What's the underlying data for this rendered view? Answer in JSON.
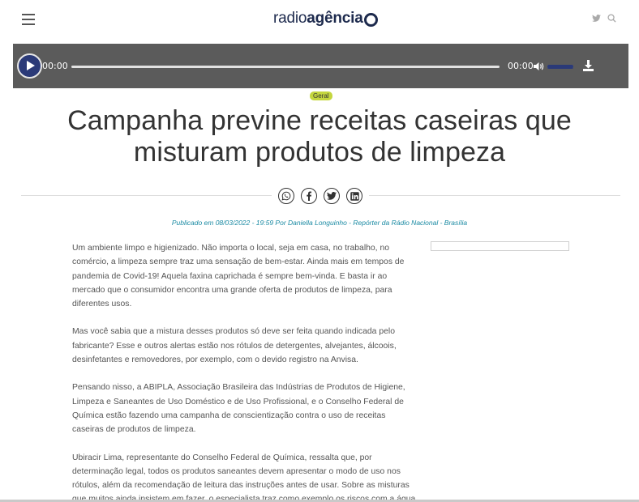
{
  "header": {
    "menu_icon": "hamburger-icon",
    "logo_light": "radio",
    "logo_bold": "agência",
    "icons": [
      "twitter-icon",
      "search-icon"
    ]
  },
  "player": {
    "current_time": "00:00",
    "duration": "00:00",
    "progress": 0,
    "volume": 1.0,
    "icons": [
      "play-icon",
      "volume-icon",
      "download-icon"
    ]
  },
  "article": {
    "category": "Geral",
    "title": "Campanha previne receitas caseiras que misturam produtos de limpeza",
    "share_icons": [
      "whatsapp-icon",
      "facebook-icon",
      "twitter-icon",
      "linkedin-icon"
    ],
    "byline": "Publicado em 08/03/2022 - 19:59 Por Daniella Longuinho - Repórter da Rádio Nacional - Brasília",
    "paragraphs": [
      "Um ambiente limpo e higienizado. Não importa o local, seja em casa, no trabalho, no comércio, a limpeza sempre traz uma sensação de bem-estar. Ainda mais em tempos de pandemia de Covid-19! Aquela faxina caprichada é sempre bem-vinda. E basta ir ao mercado que o consumidor encontra uma grande oferta de produtos de limpeza, para diferentes usos.",
      "Mas você sabia que a mistura desses produtos só deve ser feita quando indicada pelo fabricante? Esse e outros alertas estão nos rótulos de detergentes, alvejantes, álcoois, desinfetantes e removedores, por exemplo, com o devido registro na Anvisa.",
      "Pensando nisso, a ABIPLA, Associação Brasileira das Indústrias de Produtos de Higiene, Limpeza e Saneantes de Uso Doméstico e de Uso Profissional, e o Conselho Federal de Química estão fazendo uma campanha de conscientização contra o uso de receitas caseiras de produtos de limpeza.",
      "Ubiracir Lima, representante do Conselho Federal de Química, ressalta que, por determinação legal, todos os produtos saneantes devem apresentar o modo de uso nos rótulos, além da recomendação de leitura das instruções antes de usar. Sobre as misturas que muitos ainda insistem em fazer, o especialista traz como exemplo os riscos com a água"
    ]
  },
  "colors": {
    "brand": "#1d2a4d",
    "player_bg": "#5b5b5b",
    "play_button": "#2b3a78",
    "tag_bg": "#c4d63e",
    "byline": "#1a8aa3"
  }
}
